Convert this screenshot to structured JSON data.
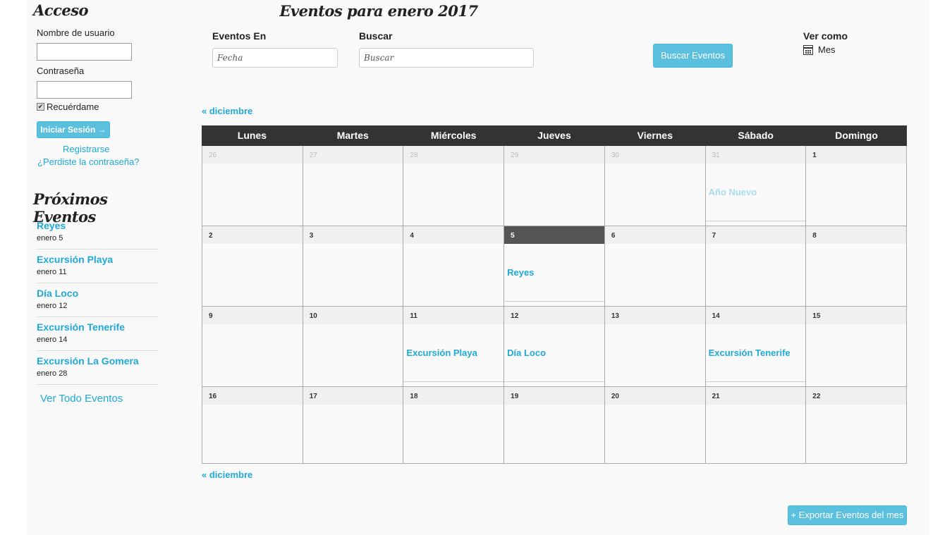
{
  "sidebar": {
    "login_title": "Acceso",
    "username_label": "Nombre de usuario",
    "username_value": "",
    "password_label": "Contraseña",
    "password_value": "",
    "remember_label": "Recuérdame",
    "remember_checked": true,
    "login_button": "Iniciar Sesión →",
    "register_link": "Registrarse",
    "forgot_link": "¿Perdiste la contraseña?",
    "upcoming_title": "Próximos Eventos",
    "upcoming": [
      {
        "name": "Reyes",
        "date": "enero 5"
      },
      {
        "name": "Excursión Playa",
        "date": "enero 11"
      },
      {
        "name": "Día Loco",
        "date": "enero 12"
      },
      {
        "name": "Excursión Tenerife",
        "date": "enero 14"
      },
      {
        "name": "Excursión La Gomera",
        "date": "enero 28"
      }
    ],
    "view_all": "Ver Todo Eventos"
  },
  "main": {
    "title": "Eventos para enero 2017",
    "events_in_label": "Eventos En",
    "date_placeholder": "Fecha",
    "search_label": "Buscar",
    "search_placeholder": "Buscar",
    "search_button": "Buscar Eventos",
    "view_as_label": "Ver como",
    "view_mode": "Mes",
    "prev_month_link": "« diciembre",
    "export_button": "+ Exportar Eventos del mes"
  },
  "calendar": {
    "weekdays": [
      "Lunes",
      "Martes",
      "Miércoles",
      "Jueves",
      "Viernes",
      "Sábado",
      "Domingo"
    ],
    "weeks": [
      [
        {
          "num": "26",
          "other": true
        },
        {
          "num": "27",
          "other": true
        },
        {
          "num": "28",
          "other": true
        },
        {
          "num": "29",
          "other": true
        },
        {
          "num": "30",
          "other": true
        },
        {
          "num": "31",
          "other": true,
          "event": "Año Nuevo"
        },
        {
          "num": "1"
        }
      ],
      [
        {
          "num": "2"
        },
        {
          "num": "3"
        },
        {
          "num": "4"
        },
        {
          "num": "5",
          "today": true,
          "event": "Reyes"
        },
        {
          "num": "6"
        },
        {
          "num": "7"
        },
        {
          "num": "8"
        }
      ],
      [
        {
          "num": "9"
        },
        {
          "num": "10"
        },
        {
          "num": "11",
          "event": "Excursión Playa"
        },
        {
          "num": "12",
          "event": "Día Loco"
        },
        {
          "num": "13"
        },
        {
          "num": "14",
          "event": "Excursión Tenerife"
        },
        {
          "num": "15"
        }
      ],
      [
        {
          "num": "16"
        },
        {
          "num": "17"
        },
        {
          "num": "18"
        },
        {
          "num": "19"
        },
        {
          "num": "20"
        },
        {
          "num": "21"
        },
        {
          "num": "22"
        }
      ]
    ]
  }
}
